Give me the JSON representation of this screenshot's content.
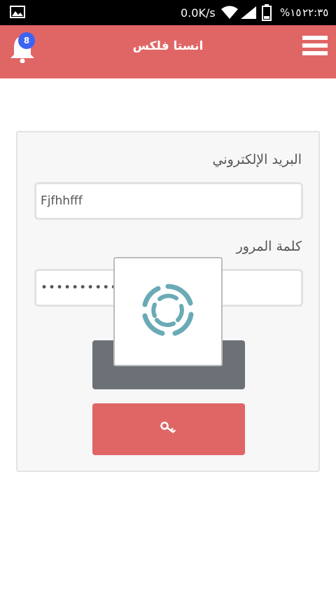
{
  "statusbar": {
    "net_speed": "0.0K/s",
    "battery_percent": "%١٥",
    "time": "٢٢:٣٥"
  },
  "appbar": {
    "title": "انستا فلكس",
    "notification_count": "8",
    "color": "#e06666"
  },
  "login_form": {
    "email_label": "البريد الإلكتروني",
    "email_value": "Fjfhhfff",
    "password_label": "كلمة المرور",
    "password_value": "••••••••••••",
    "login_button_icon": "key-icon"
  },
  "loading_dialog": {
    "spinner_icon": "loading-spinner-icon",
    "spinner_color": "#6aaab6"
  }
}
